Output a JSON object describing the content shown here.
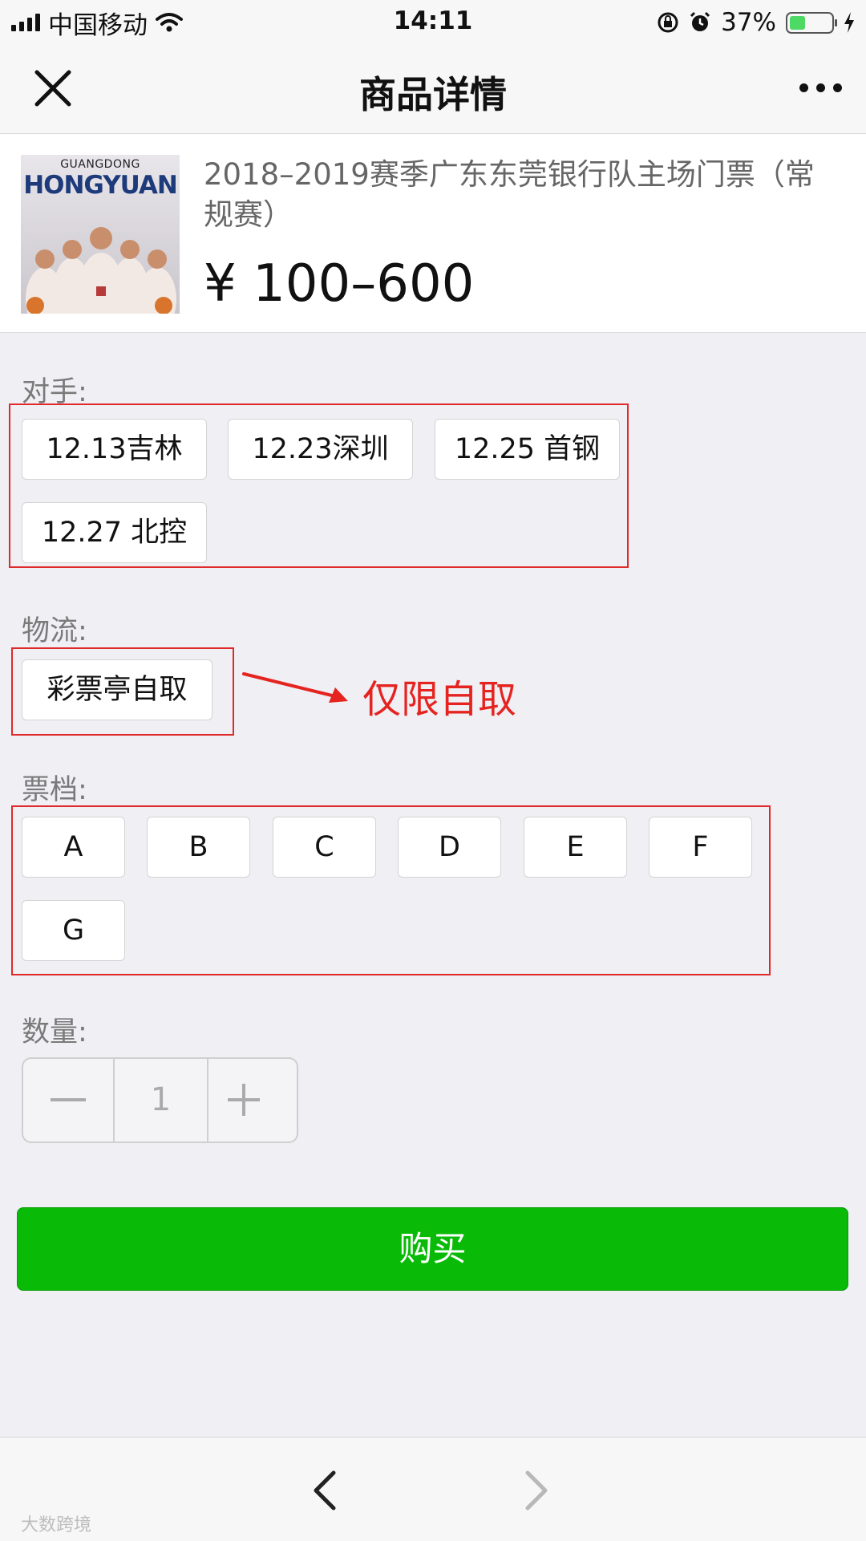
{
  "status_bar": {
    "carrier": "中国移动",
    "time": "14:11",
    "battery": "37%",
    "battery_level": 0.37
  },
  "nav": {
    "title": "商品详情",
    "close_icon": "close-icon",
    "more_icon": "more-icon"
  },
  "product": {
    "image_top_text": "GUANGDONG",
    "image_brand": "HONGYUAN",
    "title": "2018–2019赛季广东东莞银行队主场门票（常规赛）",
    "price": "¥ 100–600"
  },
  "opponent": {
    "label": "对手:",
    "options": [
      "12.13吉林",
      "12.23深圳",
      "12.25 首钢",
      "12.27 北控"
    ]
  },
  "logistics": {
    "label": "物流:",
    "options": [
      "彩票亭自取"
    ],
    "annotation": "仅限自取"
  },
  "ticket_tier": {
    "label": "票档:",
    "options": [
      "A",
      "B",
      "C",
      "D",
      "E",
      "F",
      "G"
    ]
  },
  "quantity": {
    "label": "数量:",
    "value": "1"
  },
  "buy_button": "购买",
  "toolbar": {
    "back_icon": "chevron-left-icon",
    "forward_icon": "chevron-right-icon"
  },
  "watermark": "大数跨境",
  "colors": {
    "accent_green": "#09bb07",
    "annotation_red": "#e52420",
    "background": "#efeff4"
  }
}
